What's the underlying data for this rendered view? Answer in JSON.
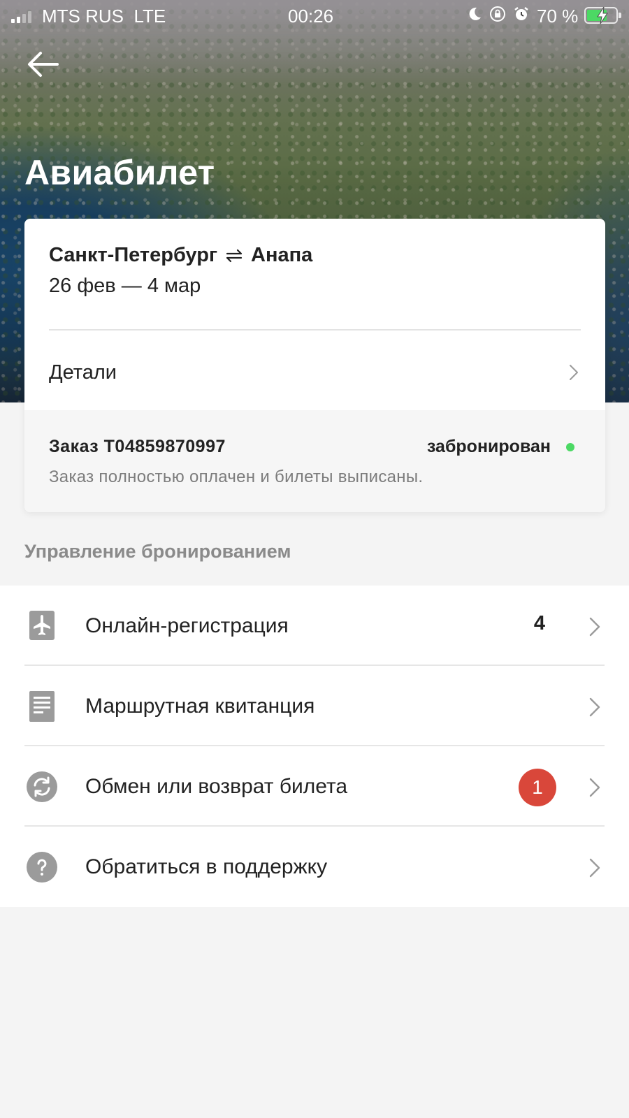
{
  "status_bar": {
    "carrier": "MTS RUS",
    "network": "LTE",
    "time": "00:26",
    "battery": "70 %",
    "battery_level": 0.7,
    "icons": [
      "moon-icon",
      "rotation-lock-icon",
      "alarm-icon",
      "charging-bolt-icon"
    ]
  },
  "header": {
    "back_icon": "arrow-left-icon",
    "title": "Авиабилет"
  },
  "trip": {
    "from": "Санкт-Петербург",
    "to": "Анапа",
    "direction_icon": "round-trip-arrows-icon",
    "dates": "26 фев — 4 мар",
    "details_label": "Детали"
  },
  "order": {
    "label": "Заказ T04859870997",
    "status": "забронирован",
    "status_color": "#4cd964",
    "note": "Заказ полностью оплачен и билеты выписаны."
  },
  "management": {
    "section_title": "Управление бронированием",
    "items": [
      {
        "label": "Онлайн-регистрация",
        "icon": "plane-icon",
        "count": "4"
      },
      {
        "label": "Маршрутная квитанция",
        "icon": "document-icon"
      },
      {
        "label": "Обмен или возврат билета",
        "icon": "refresh-icon",
        "badge": "1",
        "badge_color": "#d9473a"
      },
      {
        "label": "Обратиться в поддержку",
        "icon": "question-icon"
      }
    ]
  }
}
